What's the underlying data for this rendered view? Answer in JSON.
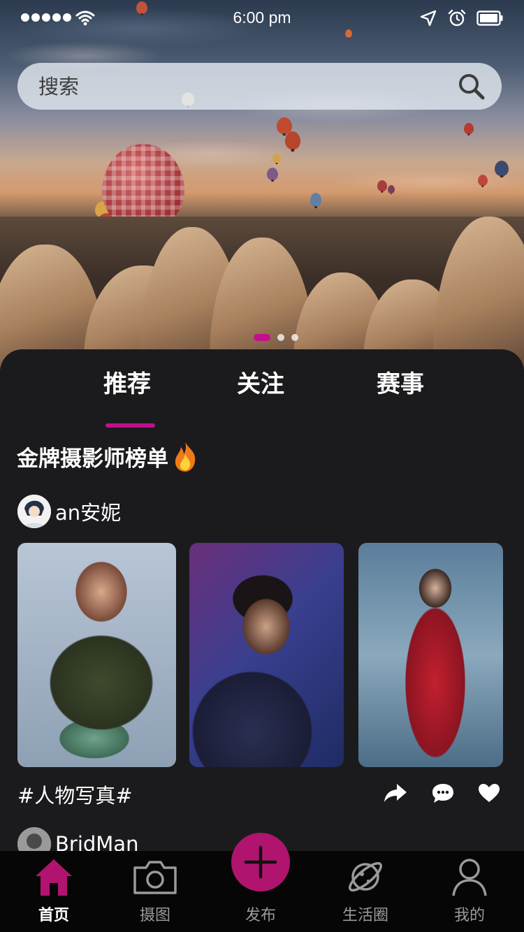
{
  "status_bar": {
    "time": "6:00 pm"
  },
  "search": {
    "placeholder": "搜索"
  },
  "carousel": {
    "count": 3,
    "active_index": 0
  },
  "tabs": [
    {
      "label": "推荐",
      "active": true
    },
    {
      "label": "关注",
      "active": false
    },
    {
      "label": "赛事",
      "active": false
    }
  ],
  "section": {
    "title": "金牌摄影师榜单"
  },
  "posts": [
    {
      "author": "an安妮",
      "tag": "#人物写真#"
    },
    {
      "author": "BridMan"
    }
  ],
  "tab_bar": [
    {
      "label": "首页",
      "icon": "home-icon",
      "active": true
    },
    {
      "label": "摄图",
      "icon": "camera-icon",
      "active": false
    },
    {
      "label": "发布",
      "icon": "plus-icon",
      "active": false
    },
    {
      "label": "生活圈",
      "icon": "planet-icon",
      "active": false
    },
    {
      "label": "我的",
      "icon": "user-icon",
      "active": false
    }
  ],
  "colors": {
    "accent": "#c40f8c",
    "panel_bg": "#1b1b1d",
    "tab_bar_bg": "#060606"
  }
}
